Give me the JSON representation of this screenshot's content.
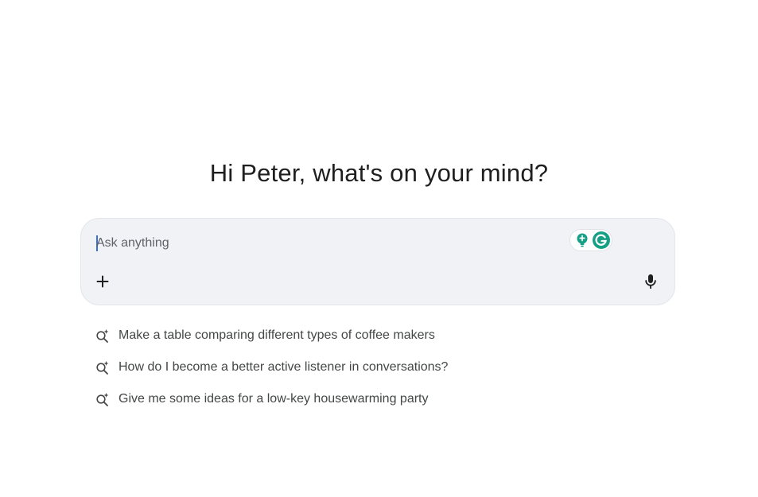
{
  "greeting": "Hi Peter, what's on your mind?",
  "composer": {
    "placeholder": "Ask anything",
    "value": "",
    "add_icon": "plus-icon",
    "mic_icon": "microphone-icon",
    "extension_icons": [
      "grammarly-bulb-icon",
      "grammarly-logo-icon"
    ]
  },
  "suggestions": [
    {
      "icon": "spark-search-icon",
      "text": "Make a table comparing different types of coffee makers"
    },
    {
      "icon": "spark-search-icon",
      "text": "How do I become a better active listener in conversations?"
    },
    {
      "icon": "spark-search-icon",
      "text": "Give me some ideas for a low-key housewarming party"
    }
  ],
  "colors": {
    "composer_bg": "#f0f2f6",
    "text": "#1f1f1f",
    "suggestion_text": "#444746",
    "caret": "#3b6fd8",
    "grammarly_green": "#15a085"
  }
}
